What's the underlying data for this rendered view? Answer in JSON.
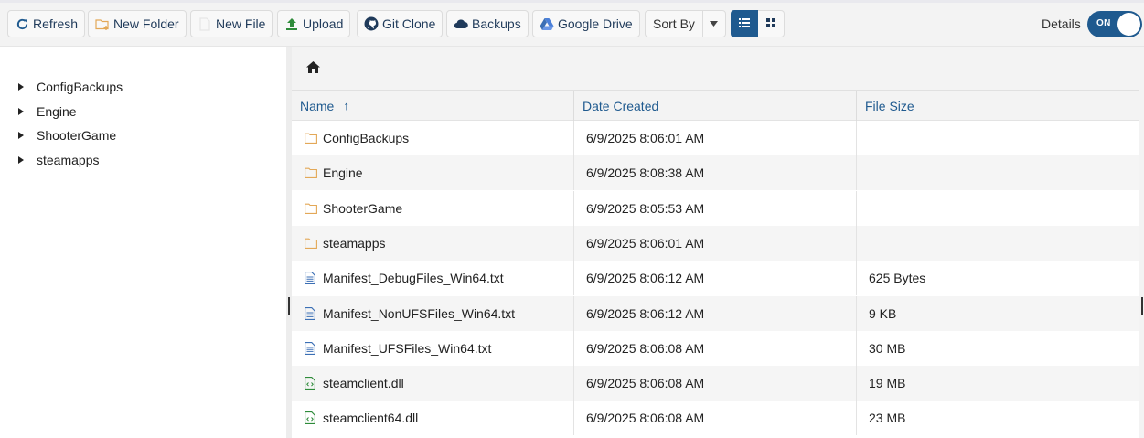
{
  "toolbar": {
    "refresh": "Refresh",
    "new_folder": "New Folder",
    "new_file": "New File",
    "upload": "Upload",
    "git_clone": "Git Clone",
    "backups": "Backups",
    "google_drive": "Google Drive",
    "sort_by": "Sort By",
    "details_label": "Details",
    "details_toggle": "ON"
  },
  "tree": {
    "items": [
      {
        "label": "ConfigBackups"
      },
      {
        "label": "Engine"
      },
      {
        "label": "ShooterGame"
      },
      {
        "label": "steamapps"
      }
    ]
  },
  "grid": {
    "columns": {
      "name": "Name",
      "date": "Date Created",
      "size": "File Size"
    },
    "sort_indicator": "↑",
    "rows": [
      {
        "name": "ConfigBackups",
        "date": "6/9/2025 8:06:01 AM",
        "size": "",
        "icon": "folder-icon"
      },
      {
        "name": "Engine",
        "date": "6/9/2025 8:08:38 AM",
        "size": "",
        "icon": "folder-icon"
      },
      {
        "name": "ShooterGame",
        "date": "6/9/2025 8:05:53 AM",
        "size": "",
        "icon": "folder-icon"
      },
      {
        "name": "steamapps",
        "date": "6/9/2025 8:06:01 AM",
        "size": "",
        "icon": "folder-icon"
      },
      {
        "name": "Manifest_DebugFiles_Win64.txt",
        "date": "6/9/2025 8:06:12 AM",
        "size": "625 Bytes",
        "icon": "text-file-icon"
      },
      {
        "name": "Manifest_NonUFSFiles_Win64.txt",
        "date": "6/9/2025 8:06:12 AM",
        "size": "9 KB",
        "icon": "text-file-icon"
      },
      {
        "name": "Manifest_UFSFiles_Win64.txt",
        "date": "6/9/2025 8:06:08 AM",
        "size": "30 MB",
        "icon": "text-file-icon"
      },
      {
        "name": "steamclient.dll",
        "date": "6/9/2025 8:06:08 AM",
        "size": "19 MB",
        "icon": "code-file-icon"
      },
      {
        "name": "steamclient64.dll",
        "date": "6/9/2025 8:06:08 AM",
        "size": "23 MB",
        "icon": "code-file-icon"
      }
    ]
  },
  "colors": {
    "accent": "#1f5a8f",
    "folder": "#e3a857",
    "text_file": "#3b6fb5",
    "code_file": "#2e8b3a",
    "upload": "#2e8b3a",
    "toolbar_bg": "#f3f3f3"
  }
}
